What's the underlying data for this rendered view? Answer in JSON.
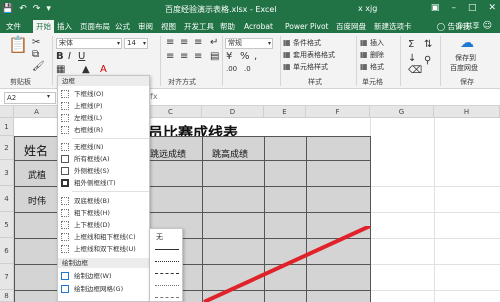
{
  "titlebar": {
    "document_title": "百度经验演示表格.xlsx - Excel",
    "user": "x xjg",
    "qat": [
      "save-icon",
      "undo-icon",
      "redo-icon"
    ],
    "window_controls": [
      "ribbon-display-icon",
      "minimize-icon",
      "restore-icon",
      "close-icon"
    ]
  },
  "tabs": [
    "文件",
    "开始",
    "插入",
    "页面布局",
    "公式",
    "审阅",
    "视图",
    "开发工具",
    "帮助",
    "Acrobat",
    "Power Pivot",
    "百度网盘",
    "新建选项卡"
  ],
  "active_tab": "开始",
  "help_text": "告诉我",
  "share_label": "共享",
  "ribbon": {
    "font_name": "宋体",
    "font_size": "14",
    "number_format": "常规",
    "groups": [
      "剪贴板",
      "对齐方式",
      "样式",
      "单元格"
    ],
    "styles": [
      "条件格式",
      "套用表格格式",
      "单元格样式"
    ],
    "cells": [
      "插入",
      "删除",
      "格式"
    ],
    "save_to_baidu": [
      "保存到",
      "百度网盘"
    ],
    "save_group": "保存"
  },
  "name_box": "A2",
  "sheet": {
    "columns": [
      "A",
      "B",
      "C",
      "D",
      "E",
      "F",
      "G",
      "H"
    ],
    "rows": [
      "1",
      "2",
      "3",
      "4",
      "5",
      "6",
      "7",
      "8",
      "9"
    ],
    "title": "员比赛成线表",
    "header_row": [
      "姓名",
      "跳远成绩",
      "跳高成绩"
    ],
    "names": [
      "武植",
      "时伟"
    ]
  },
  "border_menu": {
    "header": "边框",
    "items": [
      "下框线(O)",
      "上框线(P)",
      "左框线(L)",
      "右框线(R)",
      "无框线(N)",
      "所有框线(A)",
      "外侧框线(S)",
      "粗外侧框线(T)",
      "双底框线(B)",
      "粗下框线(H)",
      "上下框线(D)",
      "上框线和粗下框线(C)",
      "上框线和双下框线(U)"
    ],
    "draw_header": "绘制边框",
    "draw_items": [
      "绘制边框(W)",
      "绘制边框网格(G)"
    ]
  },
  "line_style_menu": {
    "none_label": "无"
  },
  "colors": {
    "excel_green": "#217346",
    "ribbon_bg": "#f3f3f3",
    "table_fill": "#d4d4d4",
    "arrow": "#e0232a"
  }
}
